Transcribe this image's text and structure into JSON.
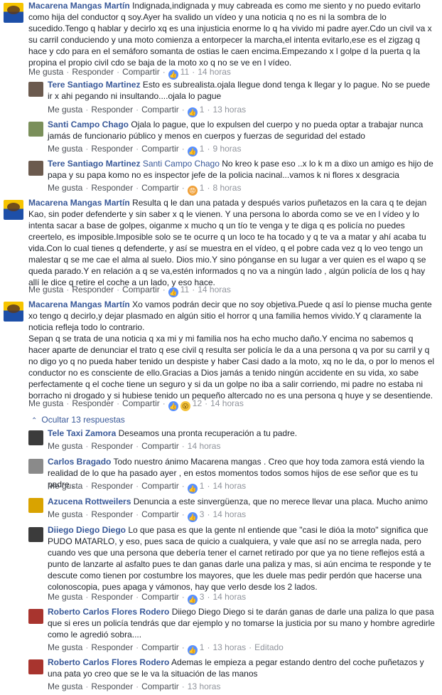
{
  "labels": {
    "like": "Me gusta",
    "reply": "Responder",
    "share": "Compartir",
    "edited": "Editado",
    "hide_replies": "Ocultar 13 respuestas"
  },
  "c1": {
    "author": "Macarena Mangas Martín",
    "text": "Indignada,indignada y muy cabreada es como me siento y no puedo evitarlo como hija del conductor q soy.Ayer ha svalido un vídeo y una noticia q no es ni la sombra de lo sucedido.Tengo q hablar y decirlo xq es una injusticia enorme lo q ha vivido mi padre ayer.Cdo un civil va x su carril conduciendo y una moto comienza a entorpecer la marcha,el intenta evitarlo,ese es el zigzag q hace y cdo para en el semáforo somanta de ostias le caen encima.Empezando x l golpe d la puerta q la propina el propio civil cdo se baja de la moto xo q no se ve en l vídeo.",
    "reactions": "11",
    "time": "14 horas"
  },
  "c2": {
    "author": "Tere Santiago Martinez",
    "text": "Esto es subrealista.ojala llegue dond tenga k llegar y lo pague. No se puede ir x ahi pegando ni insultando....ojala lo pague",
    "reactions": "1",
    "time": "13 horas"
  },
  "c3": {
    "author": "Santi Campo Chago",
    "text": "Ojala lo pague, que lo expulsen del cuerpo y no pueda optar a trabajar nunca jamás de funcionario público y menos en cuerpos y fuerzas de seguridad del estado",
    "reactions": "1",
    "time": "9 horas"
  },
  "c4": {
    "author": "Tere Santiago Martinez",
    "mention": "Santi Campo Chago",
    "text": "No kreo k pase eso ..x lo k m a dixo un amigo es hijo de papa y su papa komo no es inspector jefe de la policia nacinal...vamos k ni flores x desgracia",
    "reactions": "1",
    "time": "8 horas"
  },
  "c5": {
    "author": "Macarena Mangas Martín",
    "text": "Resulta q le dan una patada y después varios puñetazos en la cara q te dejan Kao, sin poder defenderte y sin saber x q le vienen. Y una persona lo aborda como se ve en l vídeo y lo intenta sacar a base de golpes, oiganme x mucho q un tío te venga y te diga q es policía no puedes creertelo, es imposible.Imposible solo se te ocurre q un loco te ha tocado y q te va a matar y ahí acaba tu vida.Con lo cual tienes q defenderte, y así se muestra en el vídeo, q el pobre cada vez q lo veo tengo un malestar q se me cae el alma al suelo. Dios mio.Y sino pónganse en su lugar a ver quien es el wapo q se queda parado.Y en relación a q se va,estén informados q no va a ningún lado , algún policía de los q hay allí le dice q retire el coche a un lado, y eso hace.",
    "reactions": "11",
    "time": "14 horas"
  },
  "c6": {
    "author": "Macarena Mangas Martín",
    "text": "Xo vamos podrán decir que no soy objetiva.Puede q así lo piense mucha gente xo tengo q decirlo,y dejar plasmado en algún sitio el horror q una familia hemos vivido.Y q claramente la noticia refleja todo lo contrario.",
    "text2": "Sepan q se trata de una noticia q xa mi y mi familia nos ha echo mucho daño.Y encima no sabemos q hacer aparte de denunciar el trato q ese civil q resulta ser policía le da a una persona q va por su carril y q no digo yo q no pueda haber tenido un despiste y haber Casi dado a la moto, xq no le da, o por lo menos el conductor no es consciente de ello.Gracias a Dios jamás a tenido ningún accidente en su vida, xo sabe perfectamente q el coche tiene un seguro y si da un golpe no iba a salir corriendo, mi padre no estaba ni borracho ni drogado y si hubiese tenido un pequeño altercado no es una persona q huye y se desentiende.",
    "reactions": "12",
    "time": "14 horas"
  },
  "r1": {
    "author": "Tele Taxi Zamora",
    "text": "Deseamos una pronta recuperación a tu padre.",
    "time": "14 horas"
  },
  "r2": {
    "author": "Carlos Bragado",
    "text": "Todo nuestro ánimo Macarena mangas . Creo que hoy toda zamora está viendo la realidad de lo que ha pasado ayer , en estos momentos todos somos hijos de ese señor que es tu padre ,",
    "reactions": "1",
    "time": "14 horas"
  },
  "r3": {
    "author": "Azucena Rottweilers",
    "text": "Denuncia a este sinvergüenza, que no merece llevar una placa. Mucho animo",
    "reactions": "3",
    "time": "14 horas"
  },
  "r4": {
    "author": "Diiego Diego Diego",
    "text": "Lo que pasa es que la gente nI entiende que \"casi le dióa la moto\" significa que PUDO MATARLO, y eso, pues saca de quicio a cualquiera, y vale que así no se arregla nada, pero cuando ves que una persona que debería tener el carnet retirado por que ya no tiene reflejos está a punto de lanzarte al asfalto pues te dan ganas darle una paliza y mas, si aún encima te responde y te descute como tienen por costumbre los mayores, que les duele mas pedir perdón que hacerse una colonoscopia, pues apaga y vámonos, hay que verlo desde los 2 lados.",
    "reactions": "3",
    "time": "14 horas"
  },
  "r5": {
    "author": "Roberto Carlos Flores Rodero",
    "text": "Diiego Diego Diego si te darán ganas de darle una paliza lo que pasa que si eres un policía tendrás que dar ejemplo y no tomarse la justicia por su mano y hombre agredirle como le agredió sobra....",
    "reactions": "1",
    "time": "13 horas"
  },
  "r6": {
    "author": "Roberto Carlos Flores Rodero",
    "text": "Ademas le empieza a pegar estando dentro del coche puñetazos y una pata yo creo que se le va la situación de las manos",
    "time": "13 horas"
  }
}
